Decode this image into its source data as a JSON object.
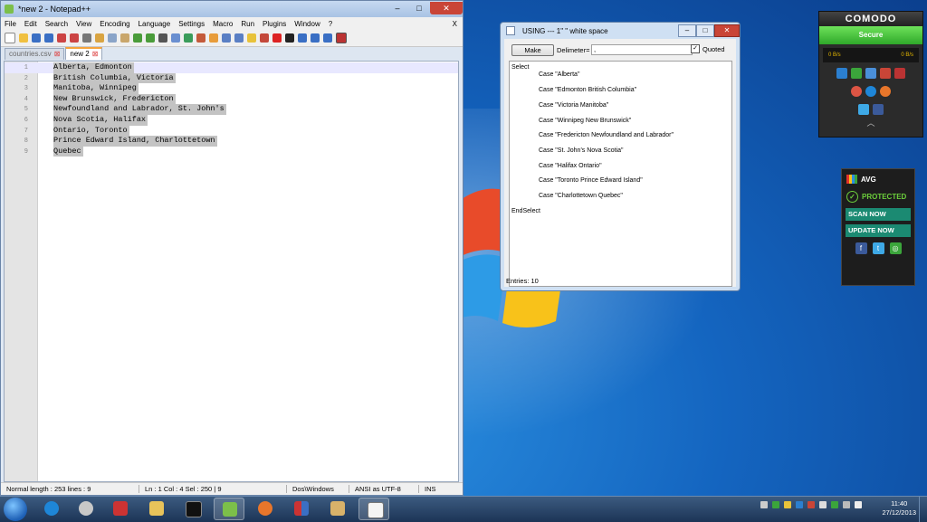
{
  "notepad": {
    "title": "*new  2 - Notepad++",
    "menu": [
      "File",
      "Edit",
      "Search",
      "View",
      "Encoding",
      "Language",
      "Settings",
      "Macro",
      "Run",
      "Plugins",
      "Window",
      "?"
    ],
    "menu_close": "X",
    "title_controls": {
      "minimize": "–",
      "maximize": "□",
      "close": "✕"
    },
    "tabs": [
      {
        "label": "countries.csv",
        "active": false
      },
      {
        "label": "new  2",
        "active": true
      }
    ],
    "lines": [
      {
        "num": "1",
        "text": "Alberta, Edmonton"
      },
      {
        "num": "2",
        "text": "British Columbia, Victoria"
      },
      {
        "num": "3",
        "text": "Manitoba, Winnipeg"
      },
      {
        "num": "4",
        "text": "New Brunswick, Fredericton"
      },
      {
        "num": "5",
        "text": "Newfoundland and Labrador, St. John's"
      },
      {
        "num": "6",
        "text": "Nova Scotia, Halifax"
      },
      {
        "num": "7",
        "text": "Ontario, Toronto"
      },
      {
        "num": "8",
        "text": "Prince Edward Island, Charlottetown"
      },
      {
        "num": "9",
        "text": "Quebec"
      }
    ],
    "status": {
      "mode": "Normal  length : 253   lines : 9",
      "pos": "Ln : 1    Col : 4    Sel : 250 | 9",
      "eol": "Dos\\Windows",
      "encoding": "ANSI as UTF-8",
      "ins": "INS"
    }
  },
  "dialog": {
    "title": "USING --- 1\" \" white space",
    "controls": {
      "minimize": "–",
      "maximize": "□",
      "close": "✕"
    },
    "make_label": "Make",
    "delimiter_label": "Delimeter=",
    "delimiter_value": ",",
    "quoted_label": "Quoted",
    "quoted_checked": true,
    "output": [
      "Select",
      "Case \"Alberta\"",
      "Case \"Edmonton British Columbia\"",
      "Case \"Victoria Manitoba\"",
      "Case \"Winnipeg New Brunswick\"",
      "Case \"Fredericton Newfoundland and Labrador\"",
      "Case \"St. John's Nova Scotia\"",
      "Case \"Halifax Ontario\"",
      "Case \"Toronto Prince Edward Island\"",
      "Case \"Charlottetown Quebec\"",
      "EndSelect"
    ],
    "status": "Entries: 10"
  },
  "comodo": {
    "title": "COMODO",
    "status": "Secure",
    "traffic_in": "0 B/s",
    "traffic_out": "0 B/s",
    "chevron": "︿"
  },
  "avg": {
    "brand": "AVG",
    "status": "PROTECTED",
    "scan_label": "SCAN NOW",
    "update_label": "UPDATE NOW",
    "social": [
      "f",
      "t",
      "◎"
    ]
  },
  "taskbar": {
    "time": "11:40",
    "date": "27/12/2013"
  },
  "colors": {
    "accent": "#1d5fb5",
    "selection": "#c3c3c3",
    "comodo_green": "#2fa82a",
    "avg_teal": "#1b8a72",
    "close_red": "#c94537"
  }
}
